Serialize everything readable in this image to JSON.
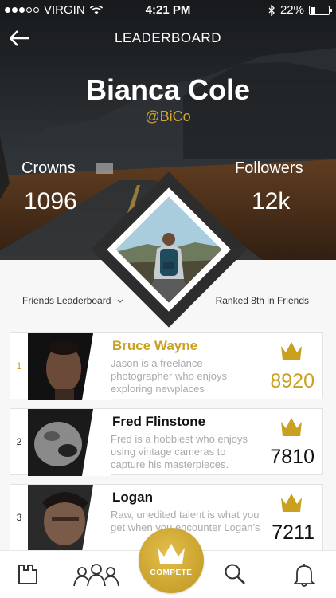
{
  "status_bar": {
    "carrier": "VIRGIN",
    "time": "4:21 PM",
    "battery_percent": "22%",
    "battery_level": 0.22,
    "icons": [
      "signal-dots-icon",
      "wifi-icon",
      "bluetooth-icon",
      "battery-icon"
    ]
  },
  "nav": {
    "title": "LEADERBOARD",
    "back_icon": "arrow-left-icon"
  },
  "profile": {
    "name": "Bianca Cole",
    "handle": "@BiCo",
    "crowns_label": "Crowns",
    "crowns_value": "1096",
    "followers_label": "Followers",
    "followers_value": "12k"
  },
  "filter": {
    "dropdown_label": "Friends Leaderboard",
    "dropdown_icon": "chevron-down-icon",
    "rank_text": "Ranked 8th in Friends"
  },
  "leaderboard": [
    {
      "rank": "1",
      "name": "Bruce Wayne",
      "description": "Jason is a freelance photographer who enjoys exploring newplaces",
      "score": "8920",
      "highlight": true
    },
    {
      "rank": "2",
      "name": "Fred Flinstone",
      "description": "Fred is a hobbiest who enjoys using vintage cameras to capture his masterpieces.",
      "score": "7810",
      "highlight": false
    },
    {
      "rank": "3",
      "name": "Logan",
      "description": "Raw, unedited talent is what you get when you encounter Logan's",
      "score": "7211",
      "highlight": false
    }
  ],
  "tabbar": {
    "compete_label": "COMPETE",
    "tabs": [
      "castle-icon",
      "people-icon",
      "crown-icon",
      "search-icon",
      "bell-icon"
    ]
  },
  "colors": {
    "gold": "#c9a020",
    "accent_handle": "#d4a72c",
    "text_dark": "#111111",
    "text_muted": "#aaaaaa"
  }
}
